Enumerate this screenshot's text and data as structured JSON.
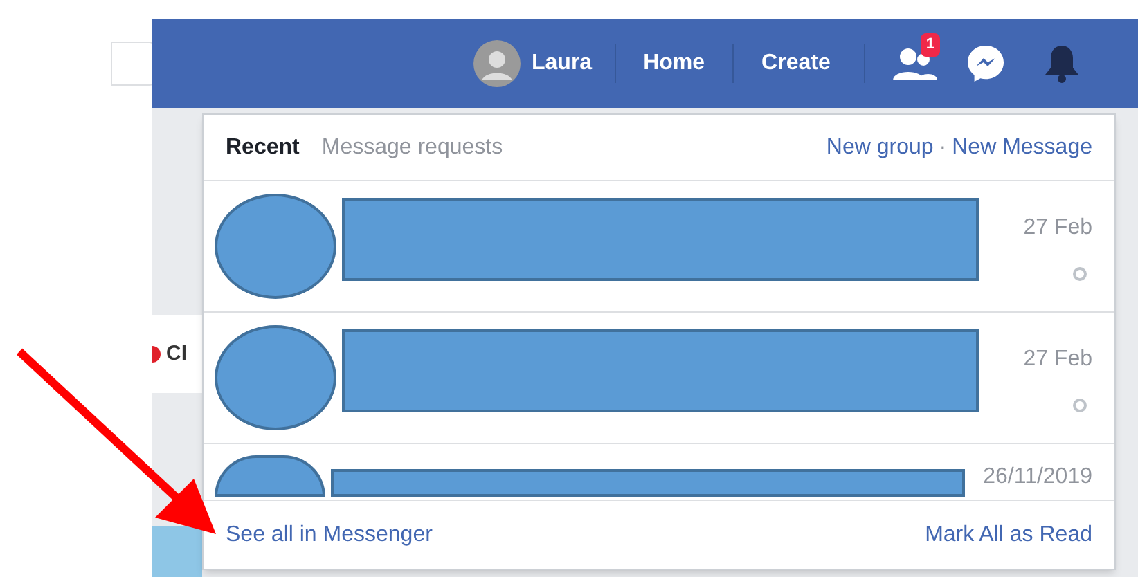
{
  "top_bar": {
    "profile": {
      "name": "Laura"
    },
    "nav": [
      "Home",
      "Create"
    ],
    "friend_requests_badge": "1"
  },
  "feed_behind": {
    "partial_text": "Cl"
  },
  "messages_panel": {
    "tabs": [
      {
        "label": "Recent",
        "selected": true
      },
      {
        "label": "Message requests",
        "selected": false
      }
    ],
    "actions": [
      "New group",
      "New Message"
    ],
    "action_separator": "·",
    "conversations": [
      {
        "time": "27 Feb",
        "cut_off": false
      },
      {
        "time": "27 Feb",
        "cut_off": false
      },
      {
        "time": "26/11/2019",
        "cut_off": true
      }
    ],
    "footer": {
      "see_all": "See all in Messenger",
      "mark_read": "Mark All as Read"
    }
  }
}
